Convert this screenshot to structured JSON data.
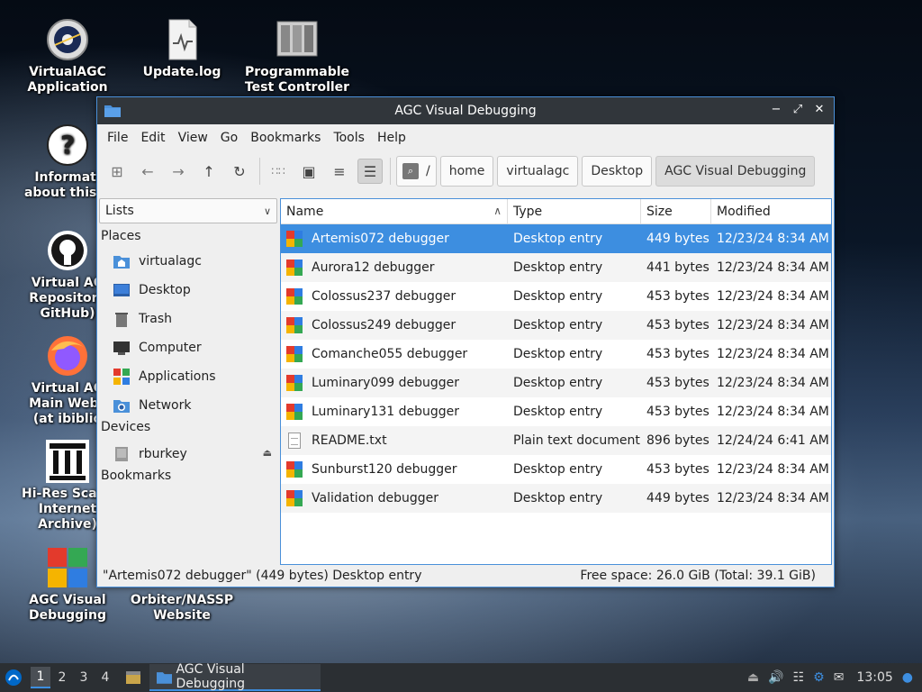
{
  "desktop": {
    "icons": [
      {
        "label": "VirtualAGC\nApplication"
      },
      {
        "label": "Update.log"
      },
      {
        "label": "Programmable\nTest Controller"
      },
      {
        "label": "Informati\nabout this V"
      },
      {
        "label": "Virtual AG\nRepository\nGitHub)"
      },
      {
        "label": "Virtual AG\nMain Webs\n(at ibiblio"
      },
      {
        "label": "Hi-Res Scans\nInternet\nArchive)"
      },
      {
        "label": "AGC Visual\nDebugging"
      },
      {
        "label": "Orbiter/NASSP\nWebsite"
      }
    ]
  },
  "window": {
    "title": "AGC Visual Debugging",
    "menu": [
      "File",
      "Edit",
      "View",
      "Go",
      "Bookmarks",
      "Tools",
      "Help"
    ],
    "breadcrumbs": [
      "/",
      "home",
      "virtualagc",
      "Desktop",
      "AGC Visual Debugging"
    ],
    "side": {
      "selector": "Lists",
      "places_header": "Places",
      "places": [
        "virtualagc",
        "Desktop",
        "Trash",
        "Computer",
        "Applications",
        "Network"
      ],
      "devices_header": "Devices",
      "devices": [
        "rburkey"
      ],
      "bookmarks_header": "Bookmarks"
    },
    "columns": {
      "name": "Name",
      "type": "Type",
      "size": "Size",
      "modified": "Modified"
    },
    "files": [
      {
        "name": "Artemis072 debugger",
        "type": "Desktop entry",
        "size": "449 bytes",
        "modified": "12/23/24 8:34 AM"
      },
      {
        "name": "Aurora12 debugger",
        "type": "Desktop entry",
        "size": "441 bytes",
        "modified": "12/23/24 8:34 AM"
      },
      {
        "name": "Colossus237 debugger",
        "type": "Desktop entry",
        "size": "453 bytes",
        "modified": "12/23/24 8:34 AM"
      },
      {
        "name": "Colossus249 debugger",
        "type": "Desktop entry",
        "size": "453 bytes",
        "modified": "12/23/24 8:34 AM"
      },
      {
        "name": "Comanche055 debugger",
        "type": "Desktop entry",
        "size": "453 bytes",
        "modified": "12/23/24 8:34 AM"
      },
      {
        "name": "Luminary099 debugger",
        "type": "Desktop entry",
        "size": "453 bytes",
        "modified": "12/23/24 8:34 AM"
      },
      {
        "name": "Luminary131 debugger",
        "type": "Desktop entry",
        "size": "453 bytes",
        "modified": "12/23/24 8:34 AM"
      },
      {
        "name": "README.txt",
        "type": "Plain text document",
        "size": "896 bytes",
        "modified": "12/24/24 6:41 AM"
      },
      {
        "name": "Sunburst120 debugger",
        "type": "Desktop entry",
        "size": "453 bytes",
        "modified": "12/23/24 8:34 AM"
      },
      {
        "name": "Validation debugger",
        "type": "Desktop entry",
        "size": "449 bytes",
        "modified": "12/23/24 8:34 AM"
      }
    ],
    "status_left": "\"Artemis072 debugger\" (449 bytes) Desktop entry",
    "status_right": "Free space: 26.0 GiB (Total: 39.1 GiB)"
  },
  "taskbar": {
    "workspaces": [
      "1",
      "2",
      "3",
      "4"
    ],
    "task_label": "AGC Visual Debugging",
    "clock": "13:05"
  },
  "colors": {
    "accent": "#3d8ee0",
    "titlebar": "#31363b",
    "taskbar": "#2b2f33"
  }
}
